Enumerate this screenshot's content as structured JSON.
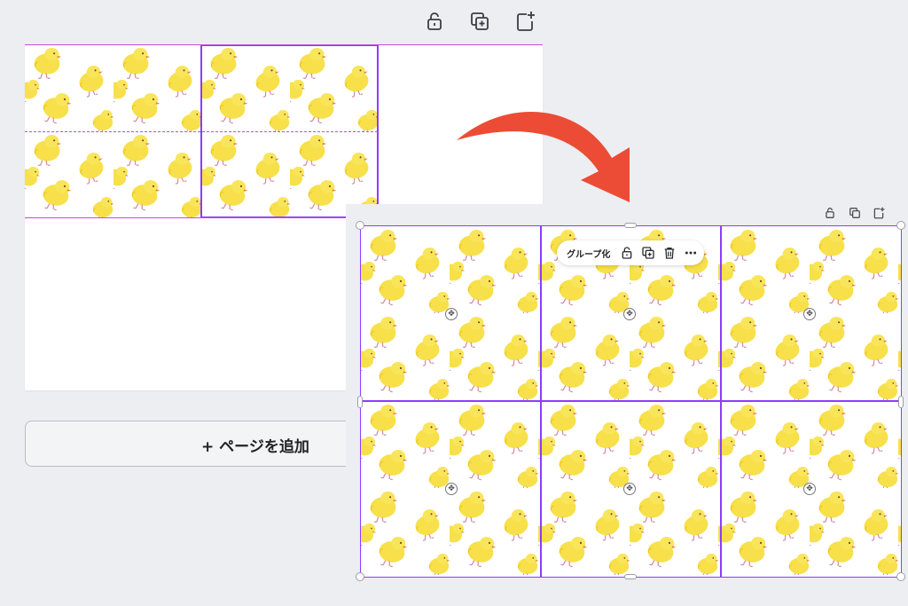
{
  "top_toolbar": {
    "icons": [
      "unlock-icon",
      "duplicate-icon",
      "add-page-icon"
    ]
  },
  "add_page_button": {
    "label": "+ ページを追加"
  },
  "selection_toolbar": {
    "group_label": "グループ化",
    "icons": [
      "unlock-icon",
      "duplicate-icon",
      "trash-icon",
      "more-icon"
    ]
  },
  "panel_toolbar": {
    "icons": [
      "unlock-icon",
      "duplicate-icon",
      "add-page-icon"
    ]
  },
  "colors": {
    "selection": "#8b3dff",
    "guide": "#c34bd9",
    "arrow": "#ec4c35",
    "chick": "#f7e04a",
    "chick_dark": "#e8c325",
    "beak": "#e58a3a",
    "feet": "#d48aa7"
  },
  "pattern_motif": "yellow-chick"
}
